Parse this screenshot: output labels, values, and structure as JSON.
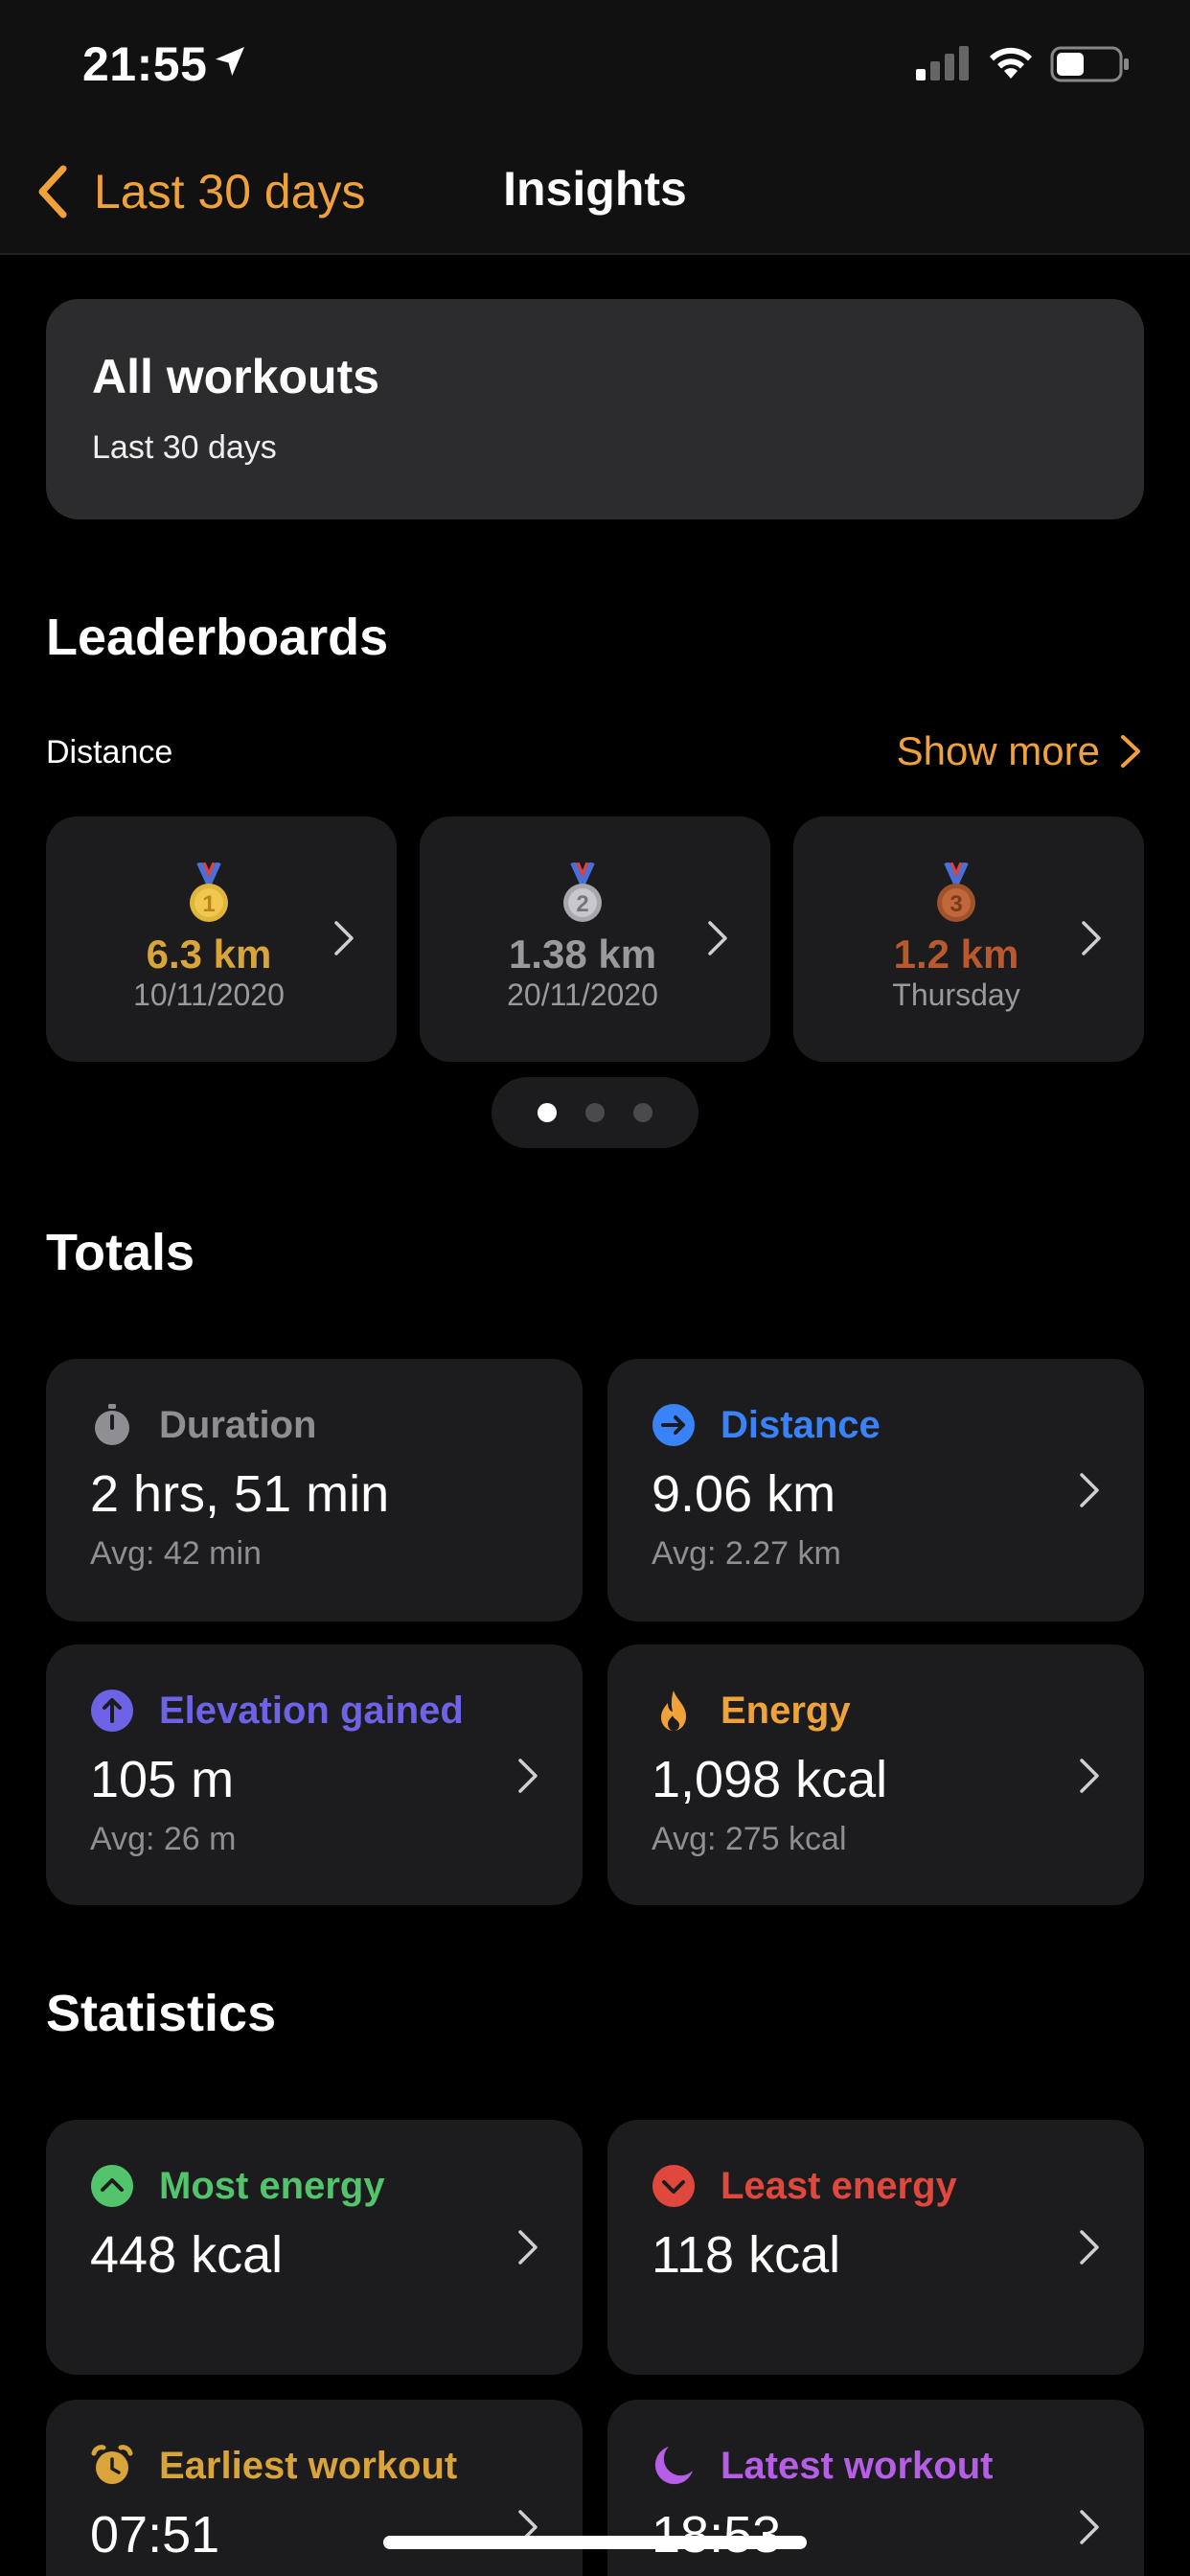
{
  "status_bar": {
    "time": "21:55"
  },
  "nav": {
    "back_label": "Last 30 days",
    "title": "Insights"
  },
  "summary": {
    "title": "All workouts",
    "subtitle": "Last 30 days"
  },
  "leaderboards": {
    "title": "Leaderboards",
    "metric_label": "Distance",
    "show_more_label": "Show more",
    "cards": [
      {
        "rank": "1",
        "value": "6.3 km",
        "date": "10/11/2020",
        "color": "#d9a43a"
      },
      {
        "rank": "2",
        "value": "1.38 km",
        "date": "20/11/2020",
        "color": "#9a9a9e"
      },
      {
        "rank": "3",
        "value": "1.2 km",
        "date": "Thursday",
        "color": "#b8592e"
      }
    ],
    "pages": 3,
    "active_page": 1
  },
  "totals": {
    "title": "Totals",
    "duration": {
      "label": "Duration",
      "value": "2 hrs, 51 min",
      "avg": "Avg: 42 min",
      "color": "#8e8e93",
      "icon": "stopwatch-icon"
    },
    "distance": {
      "label": "Distance",
      "value": "9.06 km",
      "avg": "Avg: 2.27 km",
      "color": "#3a82f7",
      "icon": "arrow-right-circle-icon"
    },
    "elevation": {
      "label": "Elevation gained",
      "value": "105 m",
      "avg": "Avg: 26 m",
      "color": "#6e63e6",
      "icon": "arrow-up-circle-icon"
    },
    "energy": {
      "label": "Energy",
      "value": "1,098 kcal",
      "avg": "Avg: 275 kcal",
      "color": "#f0a23a",
      "icon": "flame-icon"
    }
  },
  "statistics": {
    "title": "Statistics",
    "most_energy": {
      "label": "Most energy",
      "value": "448 kcal",
      "color": "#52c46b",
      "icon": "chevron-up-circle-icon"
    },
    "least_energy": {
      "label": "Least energy",
      "value": "118 kcal",
      "color": "#e0483e",
      "icon": "chevron-down-circle-icon"
    },
    "earliest_workout": {
      "label": "Earliest workout",
      "value": "07:51",
      "color": "#d9a43a",
      "icon": "alarm-icon"
    },
    "latest_workout": {
      "label": "Latest workout",
      "value": "18:53",
      "color": "#b65fe6",
      "icon": "moon-icon"
    }
  }
}
